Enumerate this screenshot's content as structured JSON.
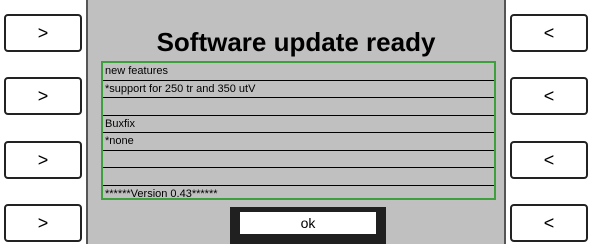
{
  "dialog": {
    "title": "Software update ready",
    "lines": [
      "new features",
      "*support for 250 tr  and 350 utV",
      "",
      "Buxfix",
      "*none",
      "",
      "",
      "******Version 0.43******"
    ],
    "ok_label": "ok"
  },
  "left_buttons": [
    ">",
    ">",
    ">",
    ">"
  ],
  "right_buttons": [
    "<",
    "<",
    "<",
    "<"
  ],
  "colors": {
    "panel_bg": "#c0c0c0",
    "list_border": "#3da03d",
    "ok_frame": "#202020"
  }
}
